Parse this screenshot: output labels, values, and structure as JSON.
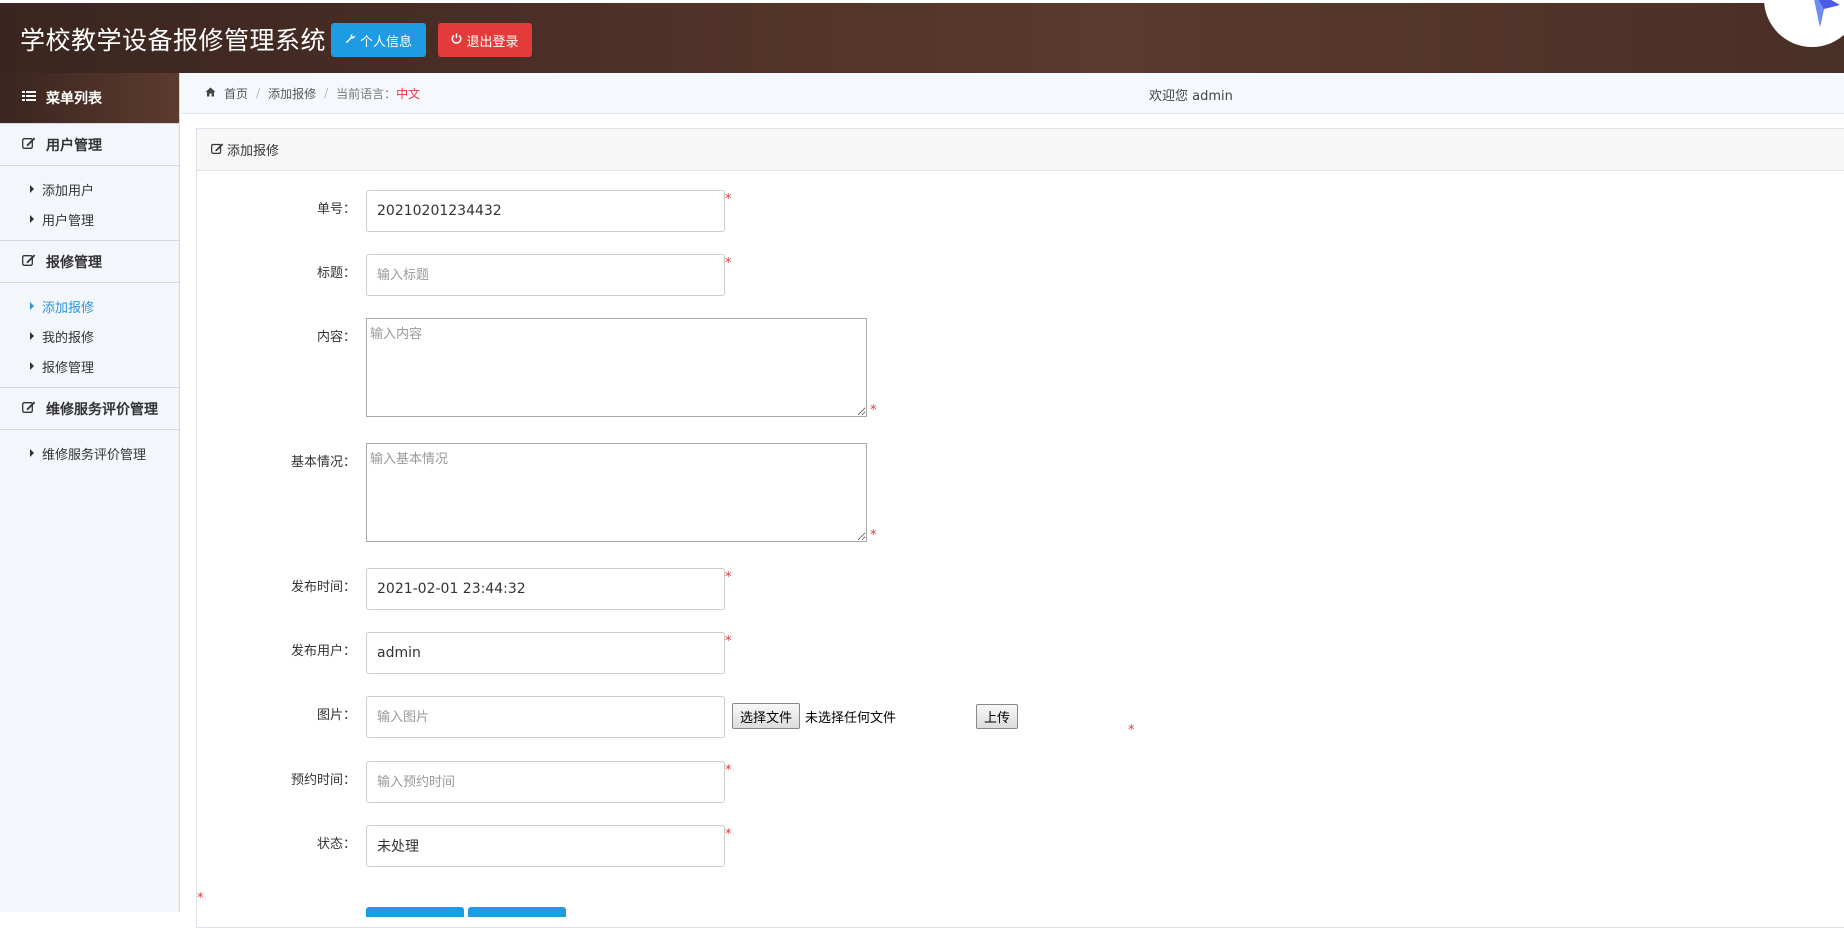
{
  "header": {
    "title": "学校教学设备报修管理系统",
    "profile_button": "个人信息",
    "logout_button": "退出登录"
  },
  "sidebar": {
    "heading": "菜单列表",
    "groups": [
      {
        "title": "用户管理",
        "items": [
          "添加用户",
          "用户管理"
        ]
      },
      {
        "title": "报修管理",
        "items": [
          "添加报修",
          "我的报修",
          "报修管理"
        ],
        "active": "添加报修"
      },
      {
        "title": "维修服务评价管理",
        "items": [
          "维修服务评价管理"
        ]
      }
    ]
  },
  "breadcrumb": {
    "home": "首页",
    "current": "添加报修",
    "language_label": "当前语言：",
    "language_value": "中文"
  },
  "welcome": "欢迎您 admin",
  "panel": {
    "title": "添加报修"
  },
  "form": {
    "order_no": {
      "label": "单号：",
      "value": "20210201234432"
    },
    "title": {
      "label": "标题：",
      "placeholder": "输入标题"
    },
    "content": {
      "label": "内容：",
      "placeholder": "输入内容"
    },
    "basic_info": {
      "label": "基本情况：",
      "placeholder": "输入基本情况"
    },
    "publish_time": {
      "label": "发布时间：",
      "value": "2021-02-01 23:44:32"
    },
    "publish_user": {
      "label": "发布用户：",
      "value": "admin"
    },
    "image": {
      "label": "图片：",
      "placeholder": "输入图片",
      "choose_button": "选择文件",
      "file_status": "未选择任何文件",
      "upload_button": "上传"
    },
    "appointment_time": {
      "label": "预约时间：",
      "placeholder": "输入预约时间"
    },
    "status": {
      "label": "状态：",
      "value": "未处理"
    },
    "required_mark": "*"
  },
  "colors": {
    "primary": "#1d9ce3",
    "danger": "#e53a3a",
    "header_bg": "#4e3127",
    "active_link": "#2a97d6"
  }
}
